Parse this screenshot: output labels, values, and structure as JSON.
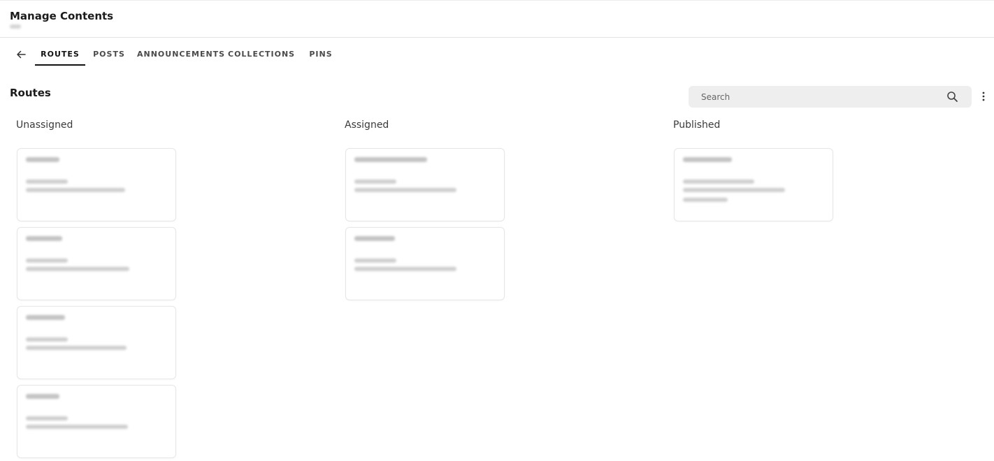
{
  "header": {
    "title": "Manage Contents"
  },
  "tabs": [
    {
      "label": "ROUTES",
      "active": true
    },
    {
      "label": "POSTS"
    },
    {
      "label": "ANNOUNCEMENTS"
    },
    {
      "label": "COLLECTIONS"
    },
    {
      "label": "PINS"
    }
  ],
  "section": {
    "title": "Routes"
  },
  "search": {
    "placeholder": "Search"
  },
  "columns": [
    {
      "title": "Unassigned",
      "card_count": 4
    },
    {
      "title": "Assigned",
      "card_count": 2
    },
    {
      "title": "Published",
      "card_count": 1
    }
  ],
  "icons": {
    "back": "arrow-left-icon",
    "search": "search-icon",
    "more": "more-vert-icon"
  },
  "colors": {
    "search_bg": "#eeeeee",
    "active_tab": "#111111",
    "card_border": "#e6e6e6"
  }
}
